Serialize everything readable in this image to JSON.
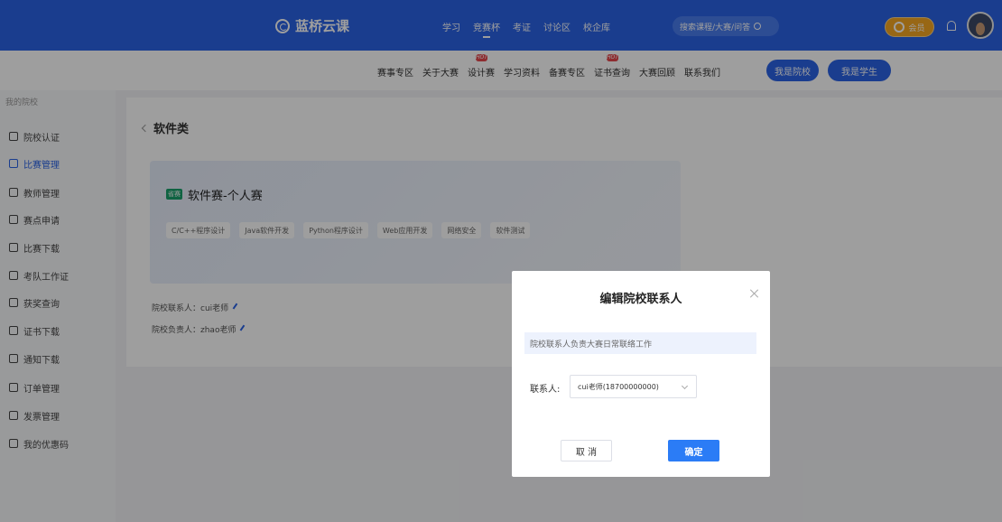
{
  "header": {
    "logo_text": "蓝桥云课",
    "nav": [
      "学习",
      "竞赛杯",
      "考证",
      "讨论区",
      "校企库"
    ],
    "active_nav": "竞赛杯",
    "search_placeholder": "搜索课程/大赛/问答",
    "vip_label": "会员",
    "brand_color": "#2b63e6"
  },
  "subnav": {
    "items": [
      {
        "label": "赛事专区",
        "hot": false
      },
      {
        "label": "关于大赛",
        "hot": false
      },
      {
        "label": "设计赛",
        "hot": true,
        "badge": "HOT"
      },
      {
        "label": "学习资料",
        "hot": false
      },
      {
        "label": "备赛专区",
        "hot": false
      },
      {
        "label": "证书查询",
        "hot": true,
        "badge": "HOT"
      },
      {
        "label": "大赛回顾",
        "hot": false
      },
      {
        "label": "联系我们",
        "hot": false
      }
    ],
    "btn_school": "我是院校",
    "btn_student": "我是学生"
  },
  "sidebar": {
    "title": "我的院校",
    "items": [
      {
        "label": "院校认证",
        "active": false
      },
      {
        "label": "比赛管理",
        "active": true
      },
      {
        "label": "教师管理",
        "active": false
      },
      {
        "label": "赛点申请",
        "active": false
      },
      {
        "label": "比赛下载",
        "active": false
      },
      {
        "label": "考队工作证",
        "active": false
      },
      {
        "label": "获奖查询",
        "active": false
      },
      {
        "label": "证书下载",
        "active": false
      },
      {
        "label": "通知下载",
        "active": false
      },
      {
        "label": "订单管理",
        "active": false
      },
      {
        "label": "发票管理",
        "active": false
      },
      {
        "label": "我的优惠码",
        "active": false
      }
    ]
  },
  "main": {
    "back_title": "软件类",
    "competition": {
      "tag": "省赛",
      "title": "软件赛-个人赛",
      "chips": [
        "C/C++程序设计",
        "Java软件开发",
        "Python程序设计",
        "Web应用开发",
        "网络安全",
        "软件测试"
      ]
    },
    "contact_line": "院校联系人：cui老师",
    "leader_line": "院校负责人：zhao老师"
  },
  "modal": {
    "title": "编辑院校联系人",
    "notice": "院校联系人负责大赛日常联络工作",
    "field_label": "联系人:",
    "selected_contact": "cui老师(18700000000)",
    "cancel_label": "取 消",
    "confirm_label": "确定",
    "confirm_color": "#2b7cf6"
  }
}
